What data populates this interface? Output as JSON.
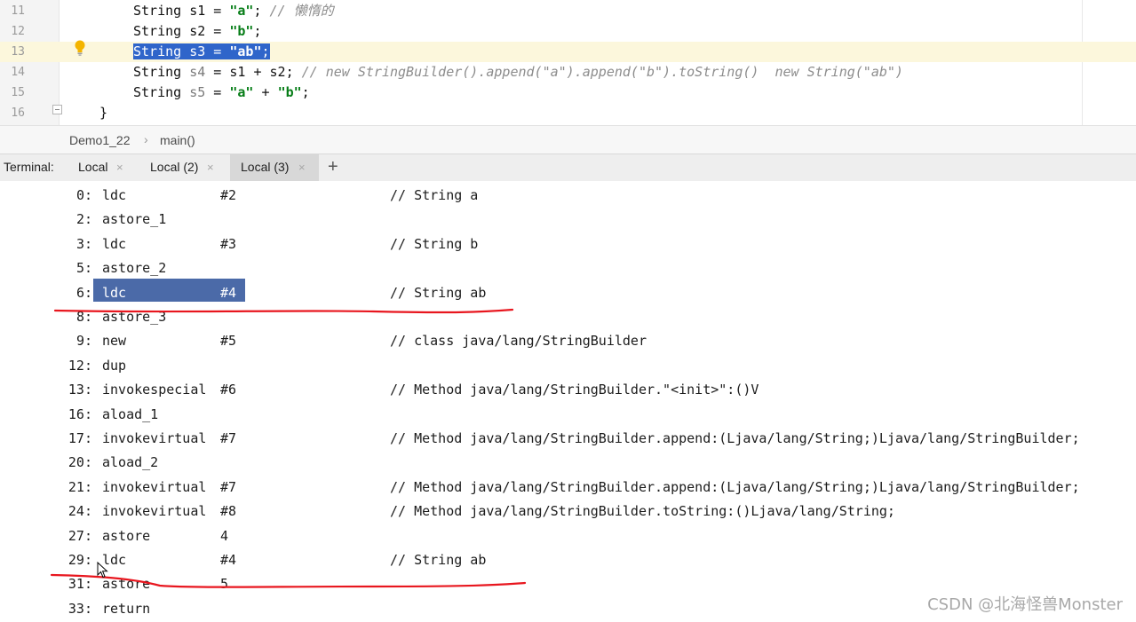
{
  "editor": {
    "lines": [
      {
        "number": "11",
        "parts": [
          [
            "var",
            "String s1 = "
          ],
          [
            "str",
            "\"a\""
          ],
          [
            "var",
            "; "
          ],
          [
            "cmt",
            "// 懒惰的"
          ]
        ]
      },
      {
        "number": "12",
        "parts": [
          [
            "var",
            "String s2 = "
          ],
          [
            "str",
            "\"b\""
          ],
          [
            "var",
            ";"
          ]
        ]
      },
      {
        "number": "13",
        "parts": [
          [
            "sel",
            "String s3 = "
          ],
          [
            "sel-str",
            "\"ab\""
          ],
          [
            "sel",
            ";"
          ]
        ]
      },
      {
        "number": "14",
        "parts": [
          [
            "var",
            "String "
          ],
          [
            "unused",
            "s4"
          ],
          [
            "var",
            " = s1 + s2; "
          ],
          [
            "cmt",
            "// new StringBuilder().append(\"a\").append(\"b\").toString()  new String(\"ab\")"
          ]
        ]
      },
      {
        "number": "15",
        "parts": [
          [
            "var",
            "String "
          ],
          [
            "unused",
            "s5"
          ],
          [
            "var",
            " = "
          ],
          [
            "str",
            "\"a\""
          ],
          [
            "var",
            " + "
          ],
          [
            "str",
            "\"b\""
          ],
          [
            "var",
            ";"
          ]
        ]
      },
      {
        "number": "16",
        "parts": [
          [
            "var",
            "}"
          ]
        ]
      }
    ],
    "current_line_index": 2
  },
  "breadcrumb": {
    "file": "Demo1_22",
    "separator": "›",
    "method": "main()"
  },
  "terminal": {
    "label": "Terminal:",
    "tabs": [
      {
        "label": "Local",
        "close": "×",
        "active": false
      },
      {
        "label": "Local (2)",
        "close": "×",
        "active": false
      },
      {
        "label": "Local (3)",
        "close": "×",
        "active": true
      }
    ],
    "add_label": "+",
    "bytecode": [
      {
        "offset": "0:",
        "op": "ldc",
        "arg": "#2",
        "comment": "// String a"
      },
      {
        "offset": "2:",
        "op": "astore_1",
        "arg": "",
        "comment": ""
      },
      {
        "offset": "3:",
        "op": "ldc",
        "arg": "#3",
        "comment": "// String b"
      },
      {
        "offset": "5:",
        "op": "astore_2",
        "arg": "",
        "comment": ""
      },
      {
        "offset": "6:",
        "op": "ldc",
        "arg": "#4",
        "comment": "// String ab"
      },
      {
        "offset": "8:",
        "op": "astore_3",
        "arg": "",
        "comment": ""
      },
      {
        "offset": "9:",
        "op": "new",
        "arg": "#5",
        "comment": "// class java/lang/StringBuilder"
      },
      {
        "offset": "12:",
        "op": "dup",
        "arg": "",
        "comment": ""
      },
      {
        "offset": "13:",
        "op": "invokespecial",
        "arg": "#6",
        "comment": "// Method java/lang/StringBuilder.\"<init>\":()V"
      },
      {
        "offset": "16:",
        "op": "aload_1",
        "arg": "",
        "comment": ""
      },
      {
        "offset": "17:",
        "op": "invokevirtual",
        "arg": "#7",
        "comment": "// Method java/lang/StringBuilder.append:(Ljava/lang/String;)Ljava/lang/StringBuilder;"
      },
      {
        "offset": "20:",
        "op": "aload_2",
        "arg": "",
        "comment": ""
      },
      {
        "offset": "21:",
        "op": "invokevirtual",
        "arg": "#7",
        "comment": "// Method java/lang/StringBuilder.append:(Ljava/lang/String;)Ljava/lang/StringBuilder;"
      },
      {
        "offset": "24:",
        "op": "invokevirtual",
        "arg": "#8",
        "comment": "// Method java/lang/StringBuilder.toString:()Ljava/lang/String;"
      },
      {
        "offset": "27:",
        "op": "astore",
        "arg": "4",
        "comment": ""
      },
      {
        "offset": "29:",
        "op": "ldc",
        "arg": "#4",
        "comment": "// String ab"
      },
      {
        "offset": "31:",
        "op": "astore",
        "arg": "5",
        "comment": ""
      },
      {
        "offset": "33:",
        "op": "return",
        "arg": "",
        "comment": ""
      }
    ],
    "selected_row_index": 4
  },
  "icons": {
    "bulb": "lightbulb-icon",
    "fold": "fold-icon",
    "cursor": "mouse-cursor-icon"
  },
  "colors": {
    "selection": "#2f65ca",
    "terminal_selection": "#4b6aa8",
    "string_literal": "#067d17",
    "comment": "#8c8c8c",
    "annotation_red": "#e8161e",
    "current_line": "#fcf7dc"
  },
  "watermark": "CSDN @北海怪兽Monster"
}
